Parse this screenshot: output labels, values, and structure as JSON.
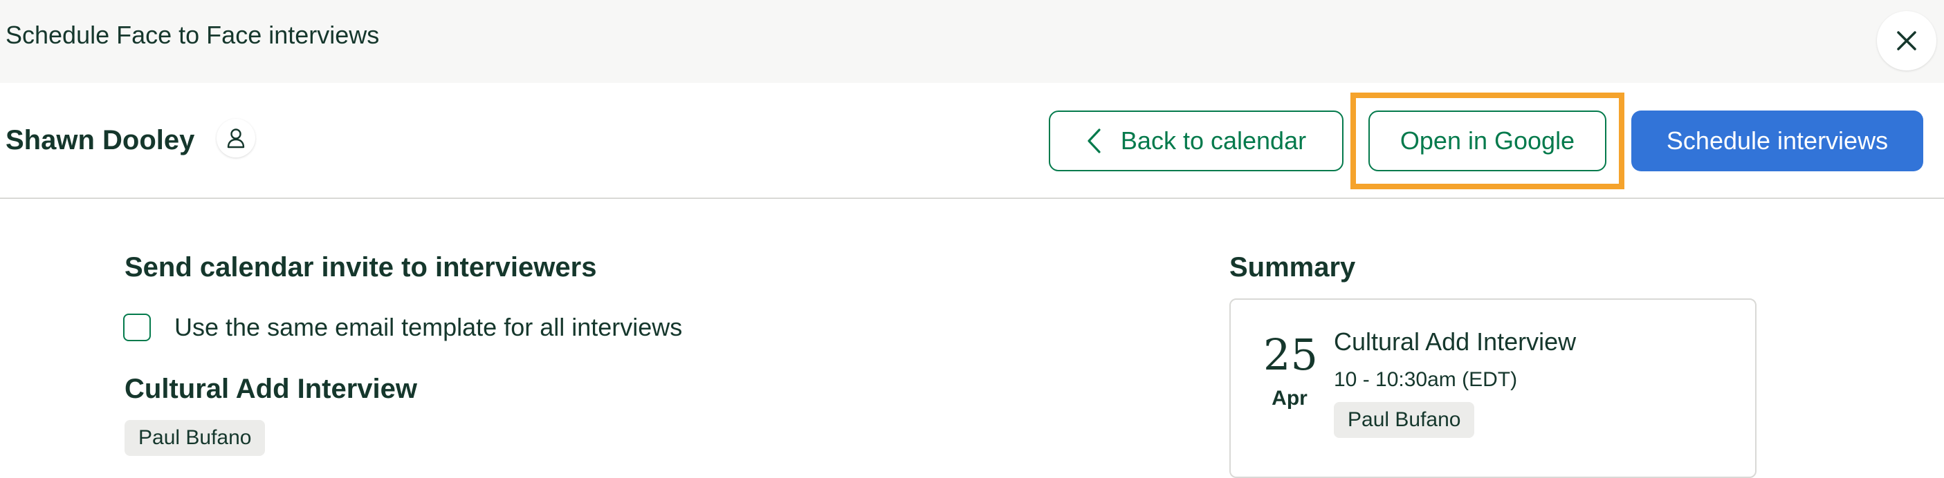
{
  "modal": {
    "title": "Schedule Face to Face interviews",
    "close_icon": "close-icon"
  },
  "header": {
    "candidate_name": "Shawn Dooley",
    "profile_icon": "person-icon",
    "back_label": "Back to calendar",
    "back_icon": "chevron-left-icon",
    "google_label": "Open in Google",
    "schedule_label": "Schedule interviews"
  },
  "invites": {
    "title": "Send calendar invite to interviewers",
    "same_template_label": "Use the same email template for all interviews",
    "same_template_checked": false
  },
  "interview": {
    "title": "Cultural Add Interview",
    "interviewer": "Paul Bufano"
  },
  "summary": {
    "title": "Summary",
    "day": "25",
    "month": "Apr",
    "interview_name": "Cultural Add Interview",
    "time": "10 - 10:30am (EDT)",
    "interviewer": "Paul Bufano"
  },
  "colors": {
    "primary_green": "#047a4c",
    "primary_blue": "#3274d8",
    "text_dark": "#15372c",
    "highlight_orange": "#f5a32c",
    "topbar_bg": "#f7f7f6",
    "chip_bg": "#ececea"
  }
}
